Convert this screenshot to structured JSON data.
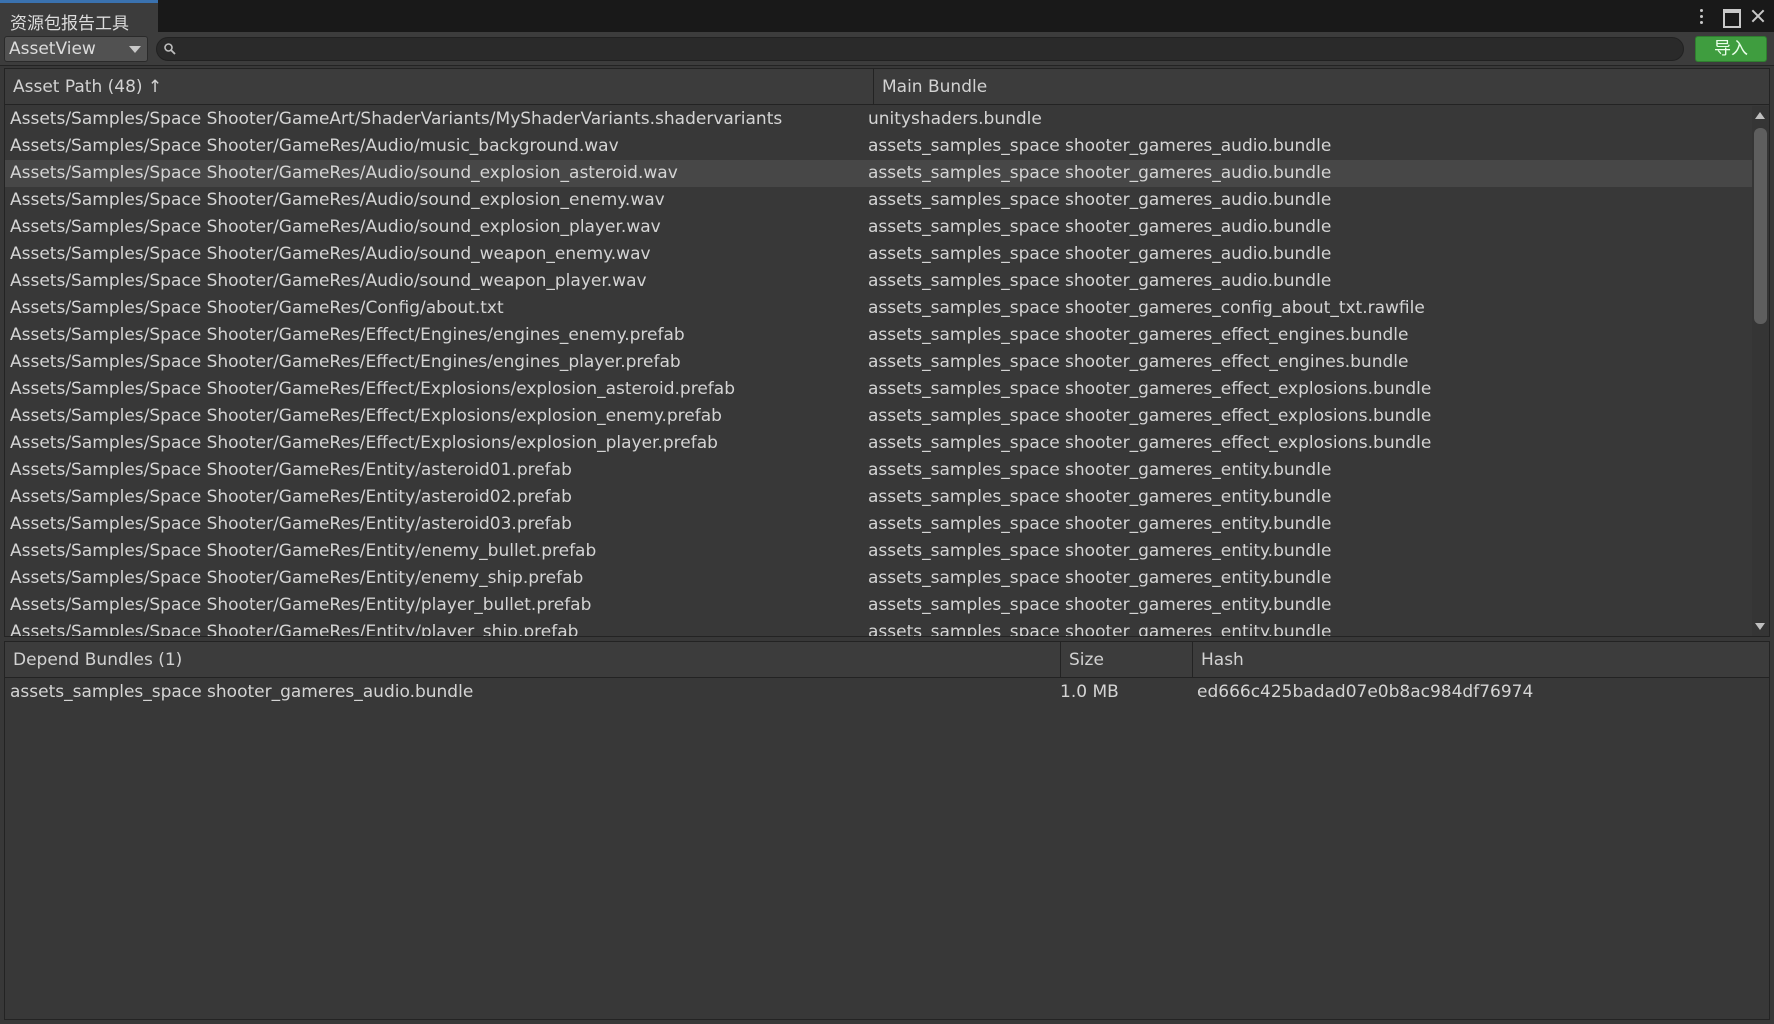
{
  "window": {
    "tab_title": "资源包报告工具"
  },
  "toolbar": {
    "view_selected": "AssetView",
    "search_value": "",
    "import_label": "导入"
  },
  "asset_table": {
    "headers": {
      "asset_path": "Asset Path (48) ↑",
      "main_bundle": "Main Bundle"
    },
    "selected_index": 2,
    "rows": [
      {
        "path": "Assets/Samples/Space Shooter/GameArt/ShaderVariants/MyShaderVariants.shadervariants",
        "bundle": "unityshaders.bundle"
      },
      {
        "path": "Assets/Samples/Space Shooter/GameRes/Audio/music_background.wav",
        "bundle": "assets_samples_space shooter_gameres_audio.bundle"
      },
      {
        "path": "Assets/Samples/Space Shooter/GameRes/Audio/sound_explosion_asteroid.wav",
        "bundle": "assets_samples_space shooter_gameres_audio.bundle"
      },
      {
        "path": "Assets/Samples/Space Shooter/GameRes/Audio/sound_explosion_enemy.wav",
        "bundle": "assets_samples_space shooter_gameres_audio.bundle"
      },
      {
        "path": "Assets/Samples/Space Shooter/GameRes/Audio/sound_explosion_player.wav",
        "bundle": "assets_samples_space shooter_gameres_audio.bundle"
      },
      {
        "path": "Assets/Samples/Space Shooter/GameRes/Audio/sound_weapon_enemy.wav",
        "bundle": "assets_samples_space shooter_gameres_audio.bundle"
      },
      {
        "path": "Assets/Samples/Space Shooter/GameRes/Audio/sound_weapon_player.wav",
        "bundle": "assets_samples_space shooter_gameres_audio.bundle"
      },
      {
        "path": "Assets/Samples/Space Shooter/GameRes/Config/about.txt",
        "bundle": "assets_samples_space shooter_gameres_config_about_txt.rawfile"
      },
      {
        "path": "Assets/Samples/Space Shooter/GameRes/Effect/Engines/engines_enemy.prefab",
        "bundle": "assets_samples_space shooter_gameres_effect_engines.bundle"
      },
      {
        "path": "Assets/Samples/Space Shooter/GameRes/Effect/Engines/engines_player.prefab",
        "bundle": "assets_samples_space shooter_gameres_effect_engines.bundle"
      },
      {
        "path": "Assets/Samples/Space Shooter/GameRes/Effect/Explosions/explosion_asteroid.prefab",
        "bundle": "assets_samples_space shooter_gameres_effect_explosions.bundle"
      },
      {
        "path": "Assets/Samples/Space Shooter/GameRes/Effect/Explosions/explosion_enemy.prefab",
        "bundle": "assets_samples_space shooter_gameres_effect_explosions.bundle"
      },
      {
        "path": "Assets/Samples/Space Shooter/GameRes/Effect/Explosions/explosion_player.prefab",
        "bundle": "assets_samples_space shooter_gameres_effect_explosions.bundle"
      },
      {
        "path": "Assets/Samples/Space Shooter/GameRes/Entity/asteroid01.prefab",
        "bundle": "assets_samples_space shooter_gameres_entity.bundle"
      },
      {
        "path": "Assets/Samples/Space Shooter/GameRes/Entity/asteroid02.prefab",
        "bundle": "assets_samples_space shooter_gameres_entity.bundle"
      },
      {
        "path": "Assets/Samples/Space Shooter/GameRes/Entity/asteroid03.prefab",
        "bundle": "assets_samples_space shooter_gameres_entity.bundle"
      },
      {
        "path": "Assets/Samples/Space Shooter/GameRes/Entity/enemy_bullet.prefab",
        "bundle": "assets_samples_space shooter_gameres_entity.bundle"
      },
      {
        "path": "Assets/Samples/Space Shooter/GameRes/Entity/enemy_ship.prefab",
        "bundle": "assets_samples_space shooter_gameres_entity.bundle"
      },
      {
        "path": "Assets/Samples/Space Shooter/GameRes/Entity/player_bullet.prefab",
        "bundle": "assets_samples_space shooter_gameres_entity.bundle"
      },
      {
        "path": "Assets/Samples/Space Shooter/GameRes/Entity/player_ship.prefab",
        "bundle": "assets_samples_space shooter_gameres_entity.bundle"
      }
    ]
  },
  "depend_table": {
    "headers": {
      "bundle": "Depend Bundles (1)",
      "size": "Size",
      "hash": "Hash"
    },
    "rows": [
      {
        "bundle": "assets_samples_space shooter_gameres_audio.bundle",
        "size": "1.0 MB",
        "hash": "ed666c425badad07e0b8ac984df76974"
      }
    ]
  }
}
